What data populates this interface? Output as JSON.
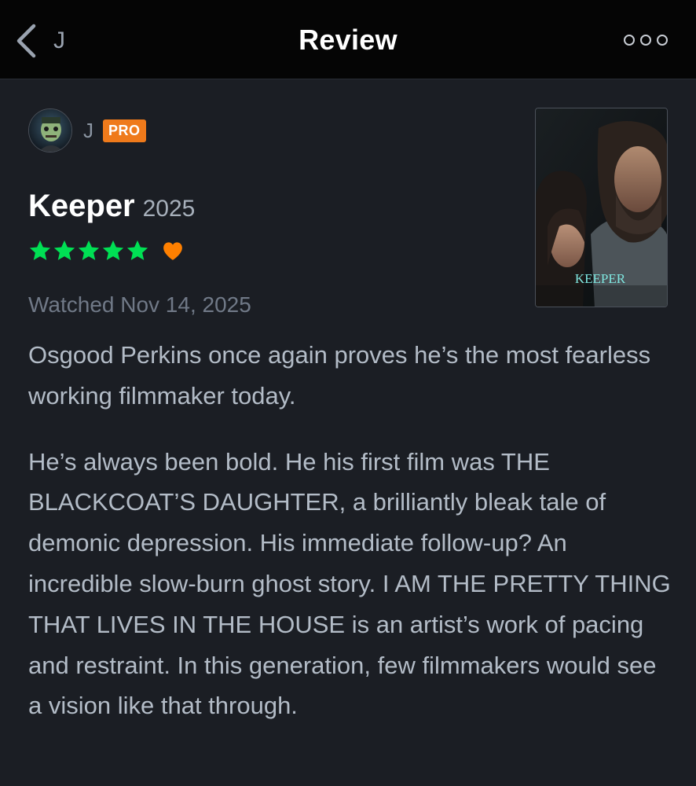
{
  "header": {
    "back_label": "J",
    "title": "Review",
    "back_icon": "chevron-left-icon",
    "more_icon": "more-options-icon"
  },
  "author": {
    "name": "J",
    "badge": "PRO",
    "badge_color": "#ef7a1b"
  },
  "film": {
    "title": "Keeper",
    "year": "2025",
    "poster_title": "KEEPER"
  },
  "rating": {
    "stars": 5,
    "max_stars": 5,
    "star_color": "#00e054",
    "liked": true,
    "heart_color": "#ff8000"
  },
  "watched": "Watched Nov 14, 2025",
  "review": {
    "paragraphs": [
      "Osgood Perkins once again proves he’s the most fearless working filmmaker today.",
      "He’s always been bold. He his first film was THE BLACKCOAT’S DAUGHTER, a brilliantly bleak tale of demonic depression. His immediate follow-up? An incredible slow-burn ghost story. I AM THE PRETTY THING THAT LIVES IN THE HOUSE is an artist’s work of pacing and restraint. In this generation, few filmmakers would see a vision like that through."
    ]
  }
}
